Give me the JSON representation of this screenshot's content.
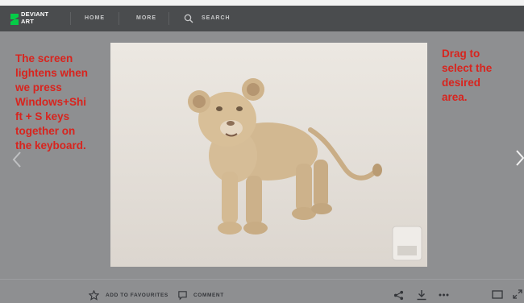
{
  "brand": {
    "logo_line1": "DEVIANT",
    "logo_line2": "ART"
  },
  "nav": {
    "home": "HOME",
    "more": "MORE",
    "search": "SEARCH"
  },
  "annotations": {
    "left": "The screen\nlightens when\nwe press\nWindows+Shi\nft + S keys\ntogether on\nthe keyboard.",
    "right": "Drag to\nselect the\ndesired\narea."
  },
  "actions": {
    "favourite": "ADD TO FAVOURITES",
    "comment": "COMMENT"
  },
  "colors": {
    "annotation": "#d8241e",
    "navbar": "#4a4c4e",
    "overlay": "#8e8f91",
    "logo_accent": "#05cc47"
  },
  "icons": [
    "deviantart-logo-icon",
    "search-icon",
    "star-icon",
    "comment-icon",
    "share-icon",
    "download-icon",
    "more-icon",
    "fullscreen-icon",
    "expand-icon",
    "chevron-left-icon",
    "chevron-right-icon"
  ]
}
